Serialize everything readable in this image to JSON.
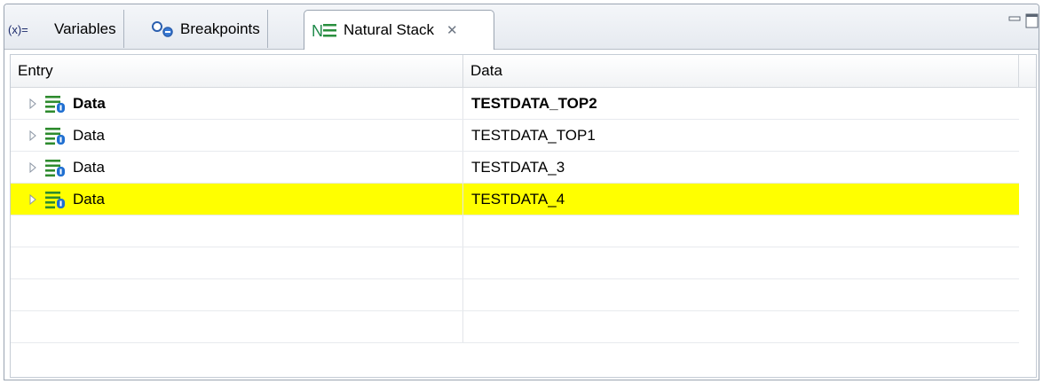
{
  "tabs": [
    {
      "label": "Variables",
      "icon": "variables-icon"
    },
    {
      "label": "Breakpoints",
      "icon": "breakpoints-icon"
    },
    {
      "label": "Natural Stack",
      "icon": "natural-stack-icon",
      "active": true,
      "close": "✕"
    }
  ],
  "table": {
    "columns": [
      "Entry",
      "Data"
    ],
    "rows": [
      {
        "entry": "Data",
        "data": "TESTDATA_TOP2",
        "bold": true,
        "highlighted": false
      },
      {
        "entry": "Data",
        "data": "TESTDATA_TOP1",
        "bold": false,
        "highlighted": false
      },
      {
        "entry": "Data",
        "data": "TESTDATA_3",
        "bold": false,
        "highlighted": false
      },
      {
        "entry": "Data",
        "data": "TESTDATA_4",
        "bold": false,
        "highlighted": true
      }
    ],
    "empty_rows": 4
  },
  "colors": {
    "highlight": "#ffff00",
    "icon_green": "#2e8b2e",
    "icon_blue": "#1f6fd1"
  }
}
